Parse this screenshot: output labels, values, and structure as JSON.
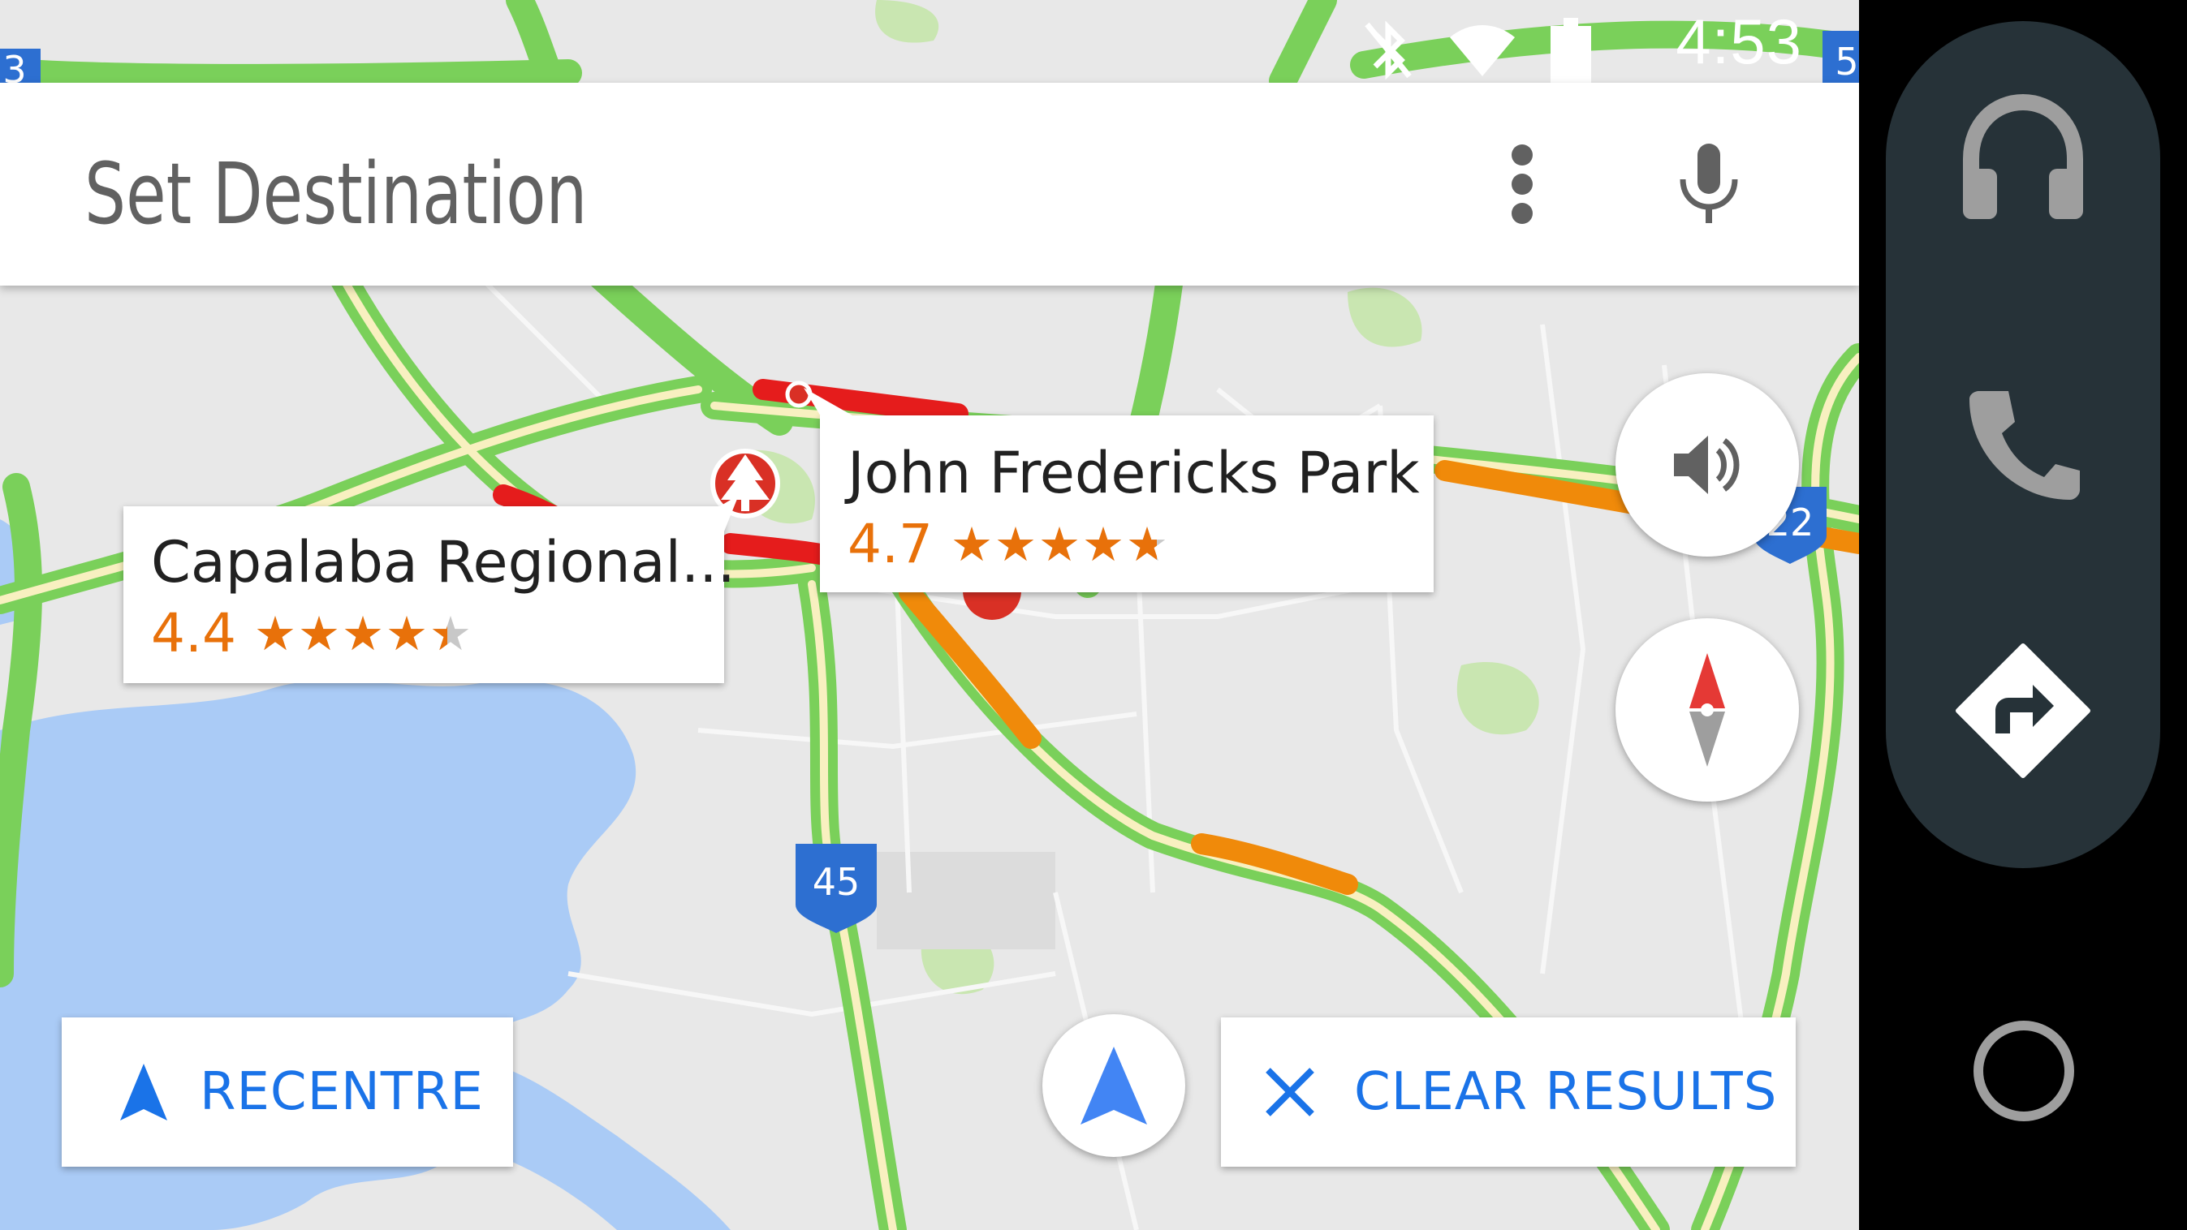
{
  "status_bar": {
    "time": "4:53",
    "icons": [
      "bluetooth-off-icon",
      "wifi-icon",
      "battery-icon"
    ]
  },
  "search_bar": {
    "title": "Set Destination",
    "more_icon": "more-vert-icon",
    "mic_icon": "mic-icon"
  },
  "map": {
    "highway_shields": [
      "45",
      "22",
      "5",
      "3"
    ],
    "colors": {
      "land": "#e8e8e8",
      "water": "#aacbf6",
      "park": "#c9e6b1",
      "traffic_clear": "#7ad05a",
      "traffic_slow": "#f08a0a",
      "traffic_heavy": "#e51c1c",
      "shield": "#2d6fd1"
    }
  },
  "places": [
    {
      "name": "Capalaba Regional...",
      "rating": "4.4",
      "stars": 4.4,
      "pin_icon": "park-pin-icon"
    },
    {
      "name": "John Fredericks Park",
      "rating": "4.7",
      "stars": 4.7,
      "pin_icon": "map-pin-icon"
    }
  ],
  "map_controls": {
    "volume_icon": "volume-icon",
    "compass_icon": "compass-icon",
    "location_icon": "navigation-arrow-icon"
  },
  "bottom_buttons": {
    "recentre": "RECENTRE",
    "clear_results": "CLEAR RESULTS"
  },
  "rail": {
    "items": [
      "headphones-icon",
      "phone-icon",
      "navigation-icon"
    ],
    "home": "home-circle-icon"
  },
  "accent_color": "#1a73e8",
  "rating_color": "#e8710a"
}
